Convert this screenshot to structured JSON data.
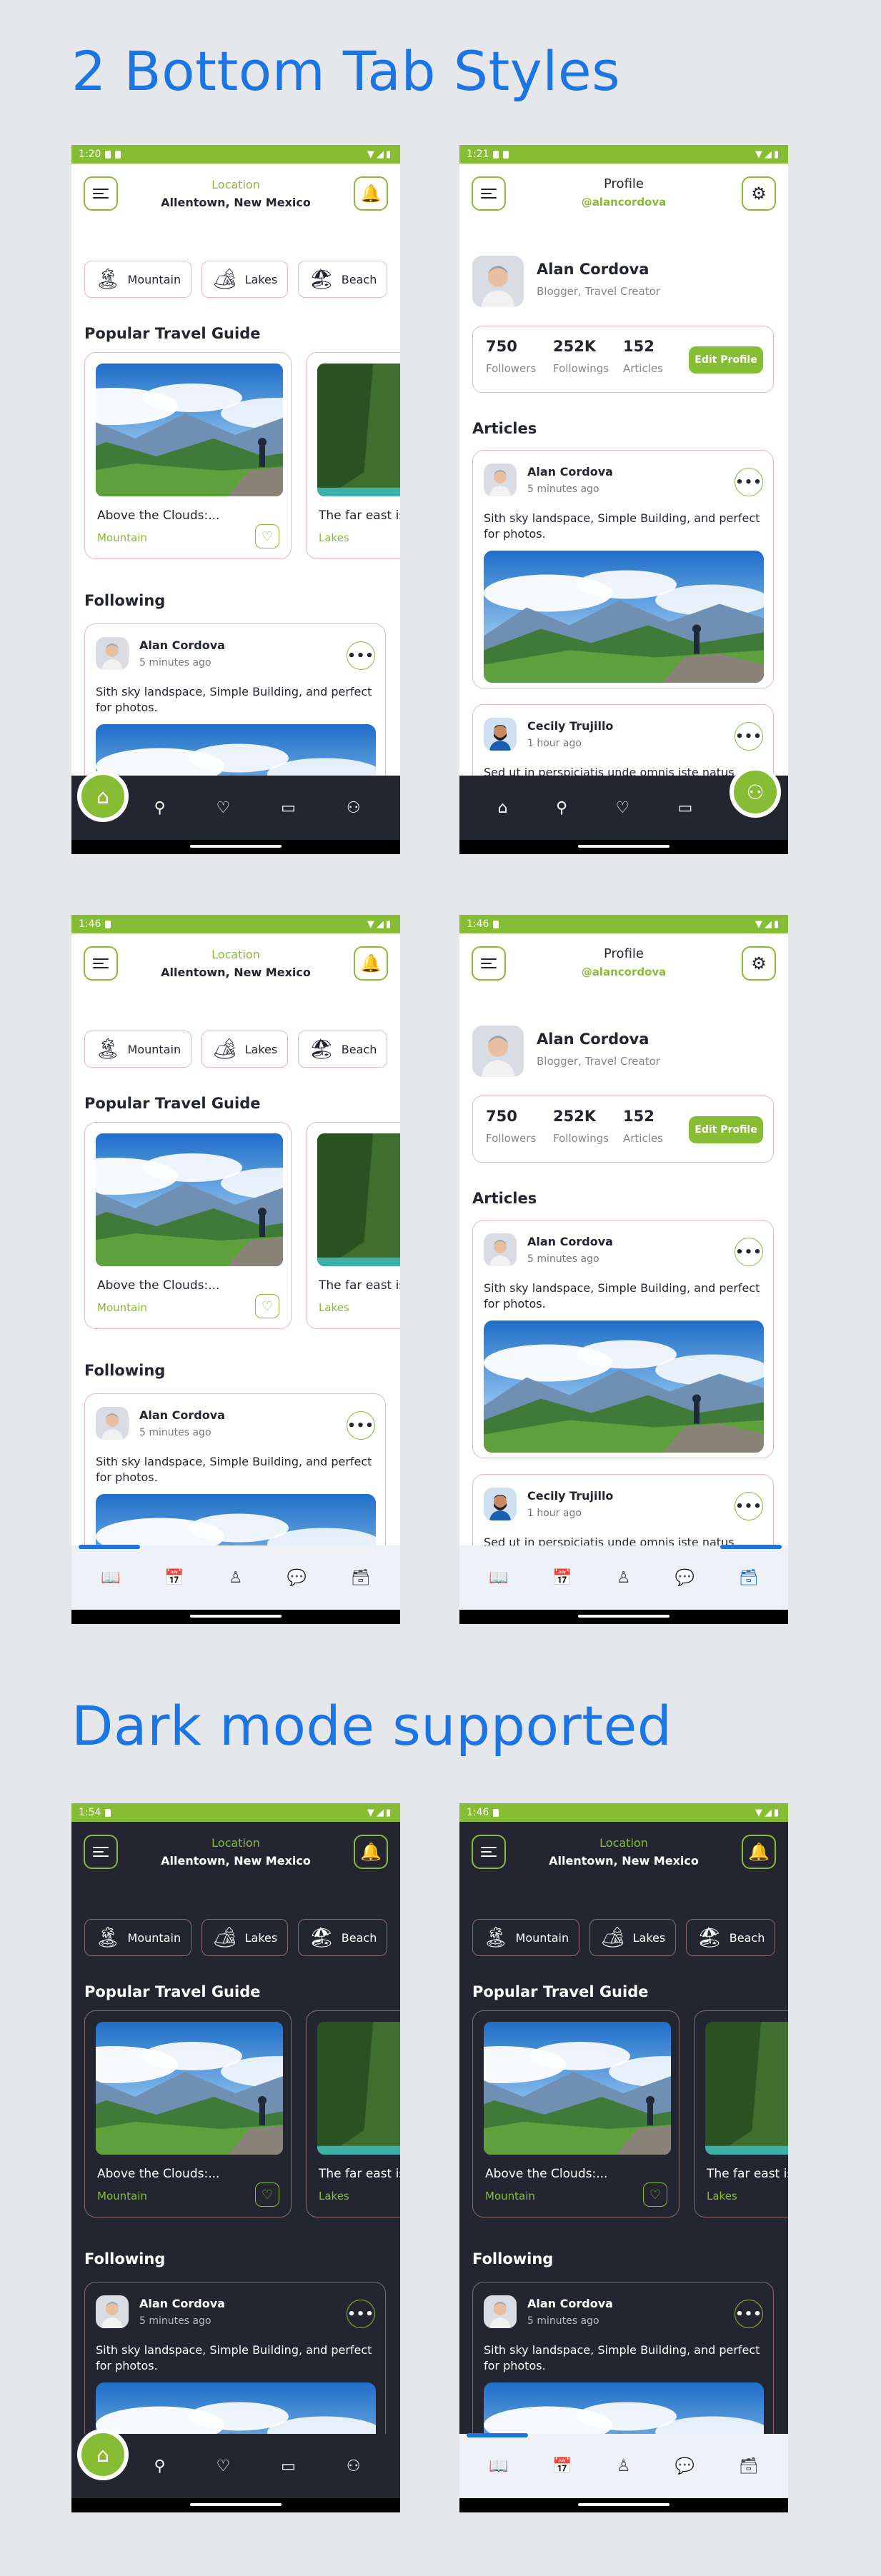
{
  "headings": {
    "tabs": "2 Bottom Tab Styles",
    "dark": "Dark mode supported"
  },
  "colors": {
    "accent": "#86bd34",
    "blue": "#1b75e2",
    "dark_bg": "#232630",
    "card_border": "#f0b6bd"
  },
  "home": {
    "location_label": "Location",
    "location_value": "Allentown, New Mexico",
    "chips": [
      {
        "icon": "🏝",
        "label": "Mountain"
      },
      {
        "icon": "🏕",
        "label": "Lakes"
      },
      {
        "icon": "🏖",
        "label": "Beach"
      }
    ],
    "popular_title": "Popular Travel Guide",
    "cards": [
      {
        "title": "Above the Clouds:...",
        "category": "Mountain"
      },
      {
        "title": "The far east is",
        "category": "Lakes"
      }
    ],
    "following_title": "Following",
    "post": {
      "name": "Alan Cordova",
      "time": "5 minutes ago",
      "body": "Sith sky landspace, Simple Building, and perfect for photos."
    }
  },
  "profile": {
    "title": "Profile",
    "handle": "@alancordova",
    "name": "Alan Cordova",
    "role": "Blogger, Travel Creator",
    "stats": [
      {
        "n": "750",
        "l": "Followers"
      },
      {
        "n": "252K",
        "l": "Followings"
      },
      {
        "n": "152",
        "l": "Articles"
      }
    ],
    "edit": "Edit Profile",
    "articles_title": "Articles",
    "articles": [
      {
        "name": "Alan Cordova",
        "time": "5 minutes ago",
        "body": "Sith sky landspace, Simple Building, and perfect for photos."
      },
      {
        "name": "Cecily Trujillo",
        "time": "1 hour ago",
        "body": "Sed ut in perspiciatis unde omnis iste natus."
      }
    ]
  },
  "phones": [
    {
      "time": "1:20",
      "style": "tab1"
    },
    {
      "time": "1:21",
      "style": "tab1"
    },
    {
      "time": "1:46",
      "style": "tab2"
    },
    {
      "time": "1:46",
      "style": "tab2"
    },
    {
      "time": "1:54",
      "style": "tab1"
    },
    {
      "time": "1:46",
      "style": "tab2"
    }
  ],
  "icons": {
    "menu": "menu-icon",
    "bell": "bell-icon",
    "gear": "gear-icon",
    "home": "home-icon",
    "search": "search-icon",
    "heart": "heart-icon",
    "chat": "chat-icon",
    "user": "user-icon",
    "book": "book-icon",
    "calendar": "calendar-icon",
    "award": "award-icon",
    "message": "message-icon",
    "archive": "archive-icon",
    "more": "more-icon"
  }
}
